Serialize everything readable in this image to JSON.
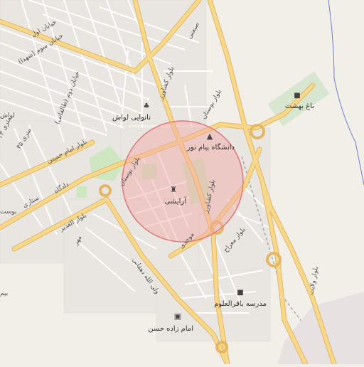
{
  "map": {
    "search_radius_visible": true,
    "colors": {
      "land": "#f2efe9",
      "block": "#e8e4de",
      "minor_road": "#ffffff",
      "major_road": "#f7d88a",
      "major_road_casing": "#e3b764",
      "park": "#cfe7c1",
      "circle_fill": "#f2a7a7",
      "circle_stroke": "#e07a7a",
      "water": "#6e7bd6",
      "railway": "#9b9b9b"
    },
    "labels": [
      {
        "id": "khiaban-som",
        "text": "خیابان سوم (شهدا)"
      },
      {
        "id": "khiaban-dovom",
        "text": "خیابان دوم (طالقانی)"
      },
      {
        "id": "khiaban-aval",
        "text": "خیابان اول"
      },
      {
        "id": "keshavarz-north",
        "text": "بلوار کشاورز"
      },
      {
        "id": "boostan-north",
        "text": "بلوار بوستان"
      },
      {
        "id": "boostan-center",
        "text": "بلوار بوستان"
      },
      {
        "id": "keshavarz-center",
        "text": "بلوار کشاورز"
      },
      {
        "id": "imam-khomeini",
        "text": "بلوار امام خمینی"
      },
      {
        "id": "sattari",
        "text": "ستاری"
      },
      {
        "id": "dadgah",
        "text": "دادگاه"
      },
      {
        "id": "ghadir",
        "text": "بلوار الغدیر"
      },
      {
        "id": "meraj",
        "text": "بلوار معراج"
      },
      {
        "id": "movahedi",
        "text": "موحدی"
      },
      {
        "id": "dehghani",
        "text": "ولی الله دهقانی"
      },
      {
        "id": "mehr",
        "text": "مهر"
      },
      {
        "id": "velayat",
        "text": "بلوار ولایت"
      },
      {
        "id": "sanaati",
        "text": "صنعتی"
      },
      {
        "id": "st-33",
        "text": "۳۳ متری"
      },
      {
        "id": "st-45",
        "text": "۴۵ متری"
      },
      {
        "id": "boostan-west",
        "text": "بوست"
      },
      {
        "id": "lavash-west",
        "text": "لواش"
      },
      {
        "id": "bim",
        "text": "بیم"
      }
    ],
    "pois": [
      {
        "id": "nanvai",
        "text": "نانوایی لواش",
        "icon": "bakery-icon"
      },
      {
        "id": "payam-noor",
        "text": "دانشگاه پیام نور",
        "icon": "university-icon"
      },
      {
        "id": "araishi",
        "text": "آرایشی",
        "icon": "shop-icon"
      },
      {
        "id": "bagh-behesht",
        "text": "باغ بهشت",
        "icon": "cemetery-icon"
      },
      {
        "id": "bagher-olom",
        "text": "مدرسه باقرالعلوم",
        "icon": "school-icon"
      },
      {
        "id": "emamzadeh",
        "text": "امام زاده حسن",
        "icon": "shrine-icon"
      }
    ]
  }
}
